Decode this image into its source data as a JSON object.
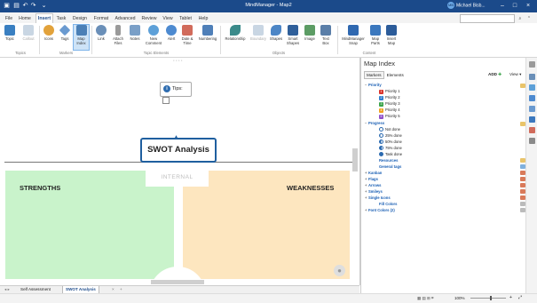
{
  "window": {
    "title": "MindManager - Map2",
    "user": "Michael Bisb...",
    "user_initials": "MB"
  },
  "menu": {
    "tabs": [
      "File",
      "Home",
      "Insert",
      "Task",
      "Design",
      "Format",
      "Advanced",
      "Review",
      "View",
      "Tablet",
      "Help"
    ],
    "active": "Insert"
  },
  "ribbon": {
    "buttons": [
      {
        "label": "Topic",
        "icon": "topic-icon",
        "color": "#3a7fc1"
      },
      {
        "label": "Callout",
        "icon": "callout-icon",
        "color": "#9fb6cc"
      },
      {
        "label": "Icons",
        "icon": "icons-icon",
        "color": "#e2a23b"
      },
      {
        "label": "Tags",
        "icon": "tags-icon",
        "color": "#6a9ad0"
      },
      {
        "label": "Map Index",
        "icon": "map-index-icon",
        "color": "#4a7fb6"
      },
      {
        "label": "Link",
        "icon": "link-icon",
        "color": "#6a8fb8"
      },
      {
        "label": "Attach Files",
        "icon": "attach-icon",
        "color": "#8a8a8a"
      },
      {
        "label": "Notes",
        "icon": "notes-icon",
        "color": "#7a9fc7"
      },
      {
        "label": "New Comment",
        "icon": "comment-icon",
        "color": "#5da0d8"
      },
      {
        "label": "Alert",
        "icon": "alert-icon",
        "color": "#4d8ad0"
      },
      {
        "label": "Date & Time",
        "icon": "calendar-icon",
        "color": "#d16b5b"
      },
      {
        "label": "Numbering",
        "icon": "numbering-icon",
        "color": "#4f7fb8"
      },
      {
        "label": "Relationship",
        "icon": "relationship-icon",
        "color": "#3a8a8a"
      },
      {
        "label": "Boundary",
        "icon": "boundary-icon",
        "color": "#a6b8c9"
      },
      {
        "label": "Shapes",
        "icon": "shapes-icon",
        "color": "#4d86c6"
      },
      {
        "label": "Smart Shapes",
        "icon": "smart-shapes-icon",
        "color": "#2f5f9a"
      },
      {
        "label": "Image",
        "icon": "image-icon",
        "color": "#5c9c64"
      },
      {
        "label": "Text Box",
        "icon": "textbox-icon",
        "color": "#5a7ea8"
      },
      {
        "label": "MindManager Snap",
        "icon": "snap-icon",
        "color": "#2f68b0"
      },
      {
        "label": "Map Parts",
        "icon": "map-parts-icon",
        "color": "#3b78be"
      },
      {
        "label": "Insert Map",
        "icon": "insert-map-icon",
        "color": "#2c5c9a"
      }
    ],
    "groups": [
      "Topics",
      "Markers",
      "Topic Elements",
      "Objects",
      "Content"
    ]
  },
  "canvas": {
    "tips_label": "Tips:",
    "central_topic": "SWOT Analysis",
    "internal_label": "INTERNAL",
    "strengths_label": "STRENGTHS",
    "weaknesses_label": "WEAKNESSES",
    "strengths_color": "#c9f3cb",
    "weaknesses_color": "#fde6bf"
  },
  "sheets": [
    "Self Assessment",
    "SWOT Analysis"
  ],
  "map_index": {
    "title": "Map Index",
    "tabs": [
      "Markers",
      "Elements"
    ],
    "add_label": "ADD",
    "view_label": "View",
    "priority": {
      "label": "Priority",
      "items": [
        {
          "text": "Priority 1",
          "num": "1",
          "color": "#d9342b"
        },
        {
          "text": "Priority 2",
          "num": "2",
          "color": "#2f7fd1"
        },
        {
          "text": "Priority 3",
          "num": "3",
          "color": "#3aa34a"
        },
        {
          "text": "Priority 4",
          "num": "4",
          "color": "#f0a31f"
        },
        {
          "text": "Priority 5",
          "num": "5",
          "color": "#8f4fc9"
        }
      ]
    },
    "progress": {
      "label": "Progress",
      "items": [
        "Not done",
        "25% done",
        "50% done",
        "75% done",
        "Task done"
      ]
    },
    "groups": [
      "Resources",
      "General tags",
      "Kanban",
      "Flags",
      "Arrows",
      "Smileys",
      "Single Icons",
      "Fill Colors",
      "Font Colors (2)"
    ]
  },
  "status": {
    "zoom": "100%"
  }
}
